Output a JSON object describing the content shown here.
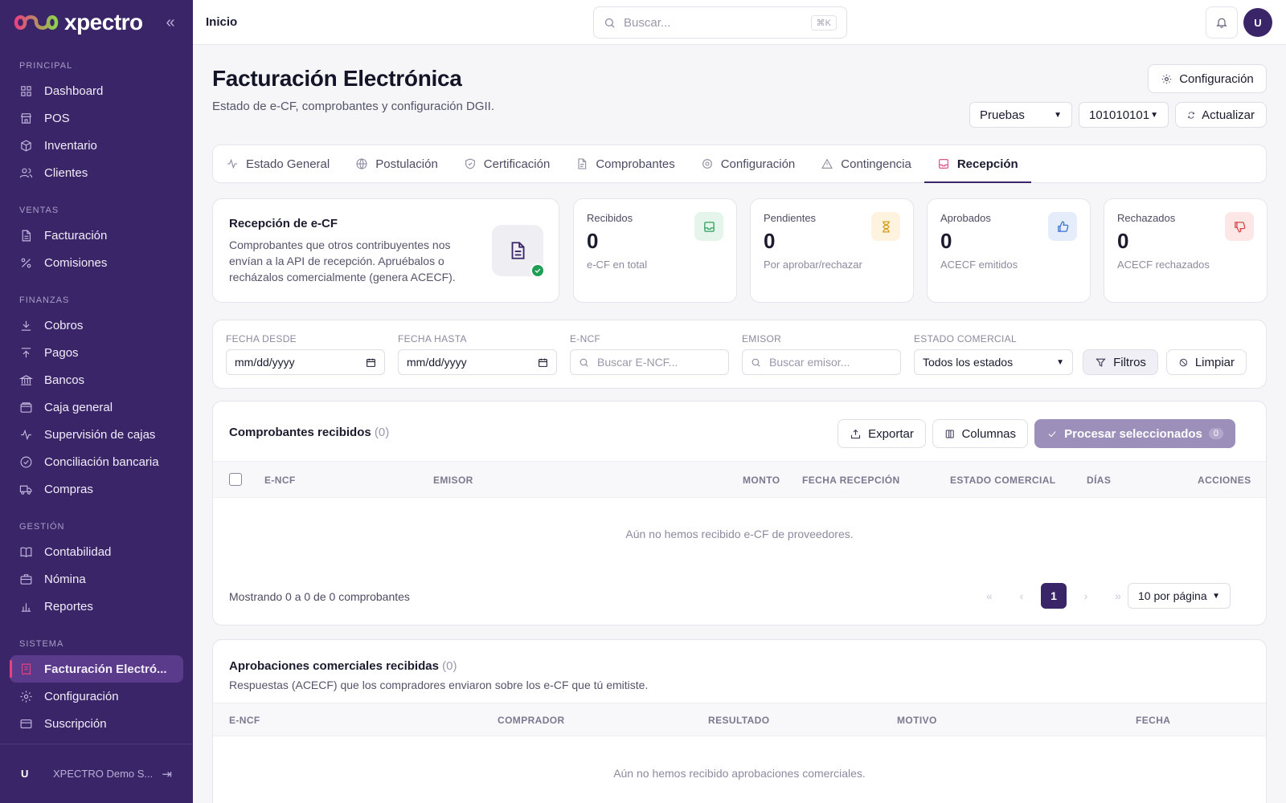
{
  "brand": {
    "name": "xpectro"
  },
  "sidebar": {
    "sections": [
      {
        "title": "PRINCIPAL",
        "items": [
          {
            "label": "Dashboard",
            "icon": "grid-icon"
          },
          {
            "label": "POS",
            "icon": "store-icon"
          },
          {
            "label": "Inventario",
            "icon": "box-icon"
          },
          {
            "label": "Clientes",
            "icon": "users-icon"
          }
        ]
      },
      {
        "title": "VENTAS",
        "items": [
          {
            "label": "Facturación",
            "icon": "file-icon"
          },
          {
            "label": "Comisiones",
            "icon": "percent-icon"
          }
        ]
      },
      {
        "title": "FINANZAS",
        "items": [
          {
            "label": "Cobros",
            "icon": "download-icon"
          },
          {
            "label": "Pagos",
            "icon": "upload-icon"
          },
          {
            "label": "Bancos",
            "icon": "bank-icon"
          },
          {
            "label": "Caja general",
            "icon": "wallet-icon"
          },
          {
            "label": "Supervisión de cajas",
            "icon": "activity-icon"
          },
          {
            "label": "Conciliación bancaria",
            "icon": "check-circle-icon"
          },
          {
            "label": "Compras",
            "icon": "truck-icon"
          }
        ]
      },
      {
        "title": "GESTIÓN",
        "items": [
          {
            "label": "Contabilidad",
            "icon": "book-icon"
          },
          {
            "label": "Nómina",
            "icon": "briefcase-icon"
          },
          {
            "label": "Reportes",
            "icon": "bar-chart-icon"
          }
        ]
      },
      {
        "title": "SISTEMA",
        "items": [
          {
            "label": "Facturación Electró...",
            "icon": "receipt-icon",
            "active": true
          },
          {
            "label": "Configuración",
            "icon": "gear-icon"
          },
          {
            "label": "Suscripción",
            "icon": "credit-card-icon"
          }
        ]
      }
    ],
    "footer": {
      "avatar": "U",
      "name": "XPECTRO Demo S..."
    }
  },
  "topbar": {
    "title": "Inicio",
    "search_placeholder": "Buscar...",
    "shortcut": "⌘K",
    "avatar": "U"
  },
  "header": {
    "title": "Facturación Electrónica",
    "subtitle": "Estado de e-CF, comprobantes y configuración DGII.",
    "config_button": "Configuración",
    "environment": "Pruebas",
    "rnc": "101010101",
    "refresh_button": "Actualizar"
  },
  "tabs": [
    {
      "label": "Estado General",
      "icon": "activity-icon"
    },
    {
      "label": "Postulación",
      "icon": "globe-icon"
    },
    {
      "label": "Certificación",
      "icon": "shield-icon"
    },
    {
      "label": "Comprobantes",
      "icon": "file-icon"
    },
    {
      "label": "Configuración",
      "icon": "gear-icon"
    },
    {
      "label": "Contingencia",
      "icon": "warning-icon"
    },
    {
      "label": "Recepción",
      "icon": "inbox-icon",
      "active": true
    }
  ],
  "intro": {
    "title": "Recepción de e-CF",
    "text": "Comprobantes que otros contribuyentes nos envían a la API de recepción. Apruébalos o recházalos comercialmente (genera ACECF)."
  },
  "stats": [
    {
      "label": "Recibidos",
      "value": "0",
      "desc": "e-CF en total",
      "icon": "inbox-icon",
      "color": "#2e9e5b",
      "bg": "#e6f5ec"
    },
    {
      "label": "Pendientes",
      "value": "0",
      "desc": "Por aprobar/rechazar",
      "icon": "hourglass-icon",
      "color": "#d99a1a",
      "bg": "#fdf3df"
    },
    {
      "label": "Aprobados",
      "value": "0",
      "desc": "ACECF emitidos",
      "icon": "thumbs-up-icon",
      "color": "#3b6fd4",
      "bg": "#e5edfb"
    },
    {
      "label": "Rechazados",
      "value": "0",
      "desc": "ACECF rechazados",
      "icon": "thumbs-down-icon",
      "color": "#d64545",
      "bg": "#fce6e6"
    }
  ],
  "filters": {
    "date_from_label": "FECHA DESDE",
    "date_from_placeholder": "mm/dd/yyyy",
    "date_to_label": "FECHA HASTA",
    "date_to_placeholder": "mm/dd/yyyy",
    "encf_label": "E-NCF",
    "encf_placeholder": "Buscar E-NCF...",
    "emisor_label": "EMISOR",
    "emisor_placeholder": "Buscar emisor...",
    "estado_label": "ESTADO COMERCIAL",
    "estado_value": "Todos los estados",
    "filter_button": "Filtros",
    "clear_button": "Limpiar"
  },
  "received": {
    "title": "Comprobantes recibidos",
    "count": "(0)",
    "export_button": "Exportar",
    "columns_button": "Columnas",
    "process_button": "Procesar seleccionados",
    "process_count": "0",
    "columns": [
      "E-NCF",
      "EMISOR",
      "MONTO",
      "FECHA RECEPCIÓN",
      "ESTADO COMERCIAL",
      "DÍAS",
      "ACCIONES"
    ],
    "empty": "Aún no hemos recibido e-CF de proveedores.",
    "footer": "Mostrando 0 a 0 de 0 comprobantes",
    "current_page": "1",
    "per_page": "10 por página"
  },
  "approvals": {
    "title": "Aprobaciones comerciales recibidas",
    "count": "(0)",
    "subtitle": "Respuestas (ACECF) que los compradores enviaron sobre los e-CF que tú emitiste.",
    "columns": [
      "E-NCF",
      "COMPRADOR",
      "RESULTADO",
      "MOTIVO",
      "FECHA"
    ],
    "empty": "Aún no hemos recibido aprobaciones comerciales."
  }
}
